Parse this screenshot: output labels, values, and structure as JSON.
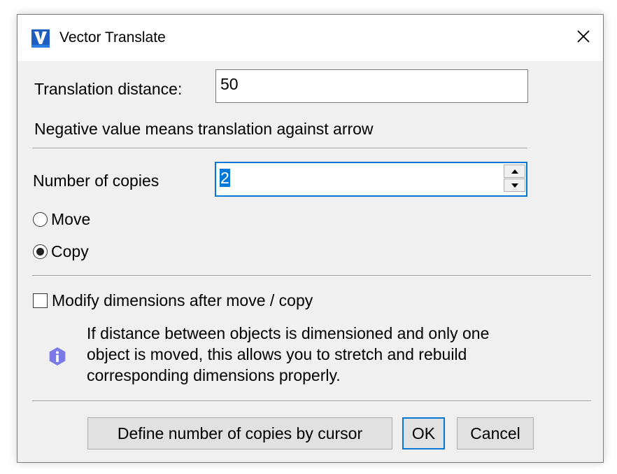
{
  "window": {
    "title": "Vector Translate",
    "app_icon": "vericad-logo-icon",
    "close_icon": "close-icon"
  },
  "translation": {
    "label": "Translation distance:",
    "value": "50",
    "hint": "Negative value means translation against arrow"
  },
  "copies": {
    "label": "Number of copies",
    "value": "2",
    "spin_up_icon": "spin-up-icon",
    "spin_down_icon": "spin-down-icon"
  },
  "mode": {
    "options": [
      {
        "label": "Move",
        "selected": false
      },
      {
        "label": "Copy",
        "selected": true
      }
    ]
  },
  "modify_dimensions": {
    "label": "Modify dimensions after move / copy",
    "checked": false
  },
  "info": {
    "icon": "info-icon",
    "lines": [
      "If distance between objects is dimensioned and only one",
      "object is moved, this allows you to stretch and rebuild",
      "corresponding dimensions properly."
    ]
  },
  "buttons": {
    "define_by_cursor": "Define number of copies by cursor",
    "ok": "OK",
    "cancel": "Cancel"
  },
  "colors": {
    "accent": "#0078d7",
    "dialog_bg": "#f0f0f0",
    "info_icon": "#7b78e8"
  }
}
